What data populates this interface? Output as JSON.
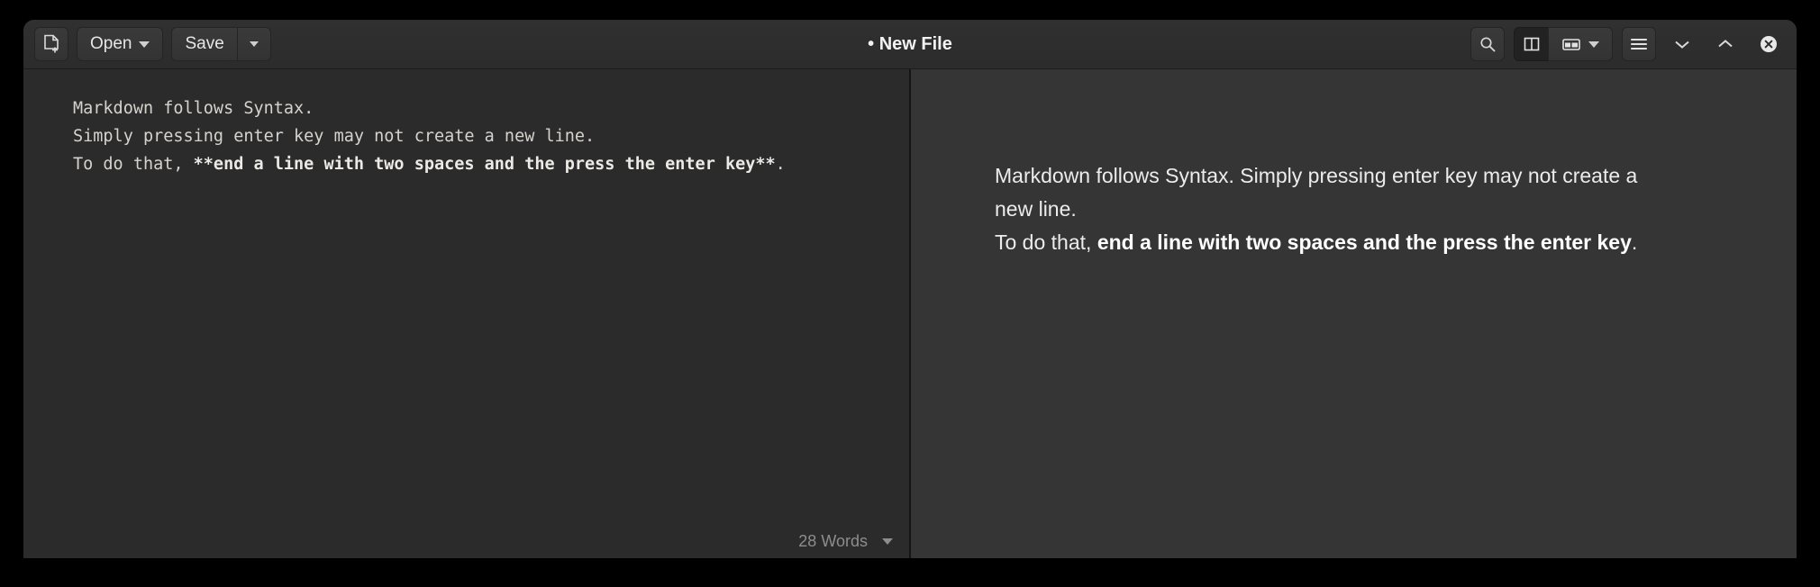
{
  "window": {
    "title": "• New File",
    "modified_marker": "•",
    "title_text": "New File"
  },
  "toolbar": {
    "new_file_icon": "new-file-icon",
    "open_label": "Open",
    "open_caret": "chevron-down-icon",
    "save_label": "Save",
    "save_menu_caret": "chevron-down-icon"
  },
  "header_actions": {
    "search_icon": "search-icon",
    "split_view_icon": "split-view-icon",
    "preview_mode_icon": "preview-layout-icon",
    "preview_mode_caret": "chevron-down-icon",
    "menu_icon": "hamburger-menu-icon",
    "minimize_icon": "chevron-down-icon",
    "maximize_icon": "chevron-up-icon",
    "close_icon": "close-circle-icon"
  },
  "editor": {
    "lines": [
      {
        "text": "Markdown follows Syntax."
      },
      {
        "text": "Simply pressing enter key may not create a new line."
      }
    ],
    "line3_prefix": "To do that, ",
    "line3_bold": "**end a line with two spaces and the press the enter key**",
    "line3_suffix": ".",
    "word_count": "28 Words"
  },
  "preview": {
    "paragraph1": "Markdown follows Syntax. Simply pressing enter key may not create a new line.",
    "paragraph2_prefix": "To do that, ",
    "paragraph2_bold": "end a line with two spaces and the press the enter key",
    "paragraph2_suffix": "."
  },
  "colors": {
    "desktop": "#000000",
    "header": "#2e2e2e",
    "editor_bg": "#2b2b2b",
    "preview_bg": "#353535",
    "divider": "#151515",
    "text": "#d6d3ce",
    "muted": "#8d8d8d"
  }
}
